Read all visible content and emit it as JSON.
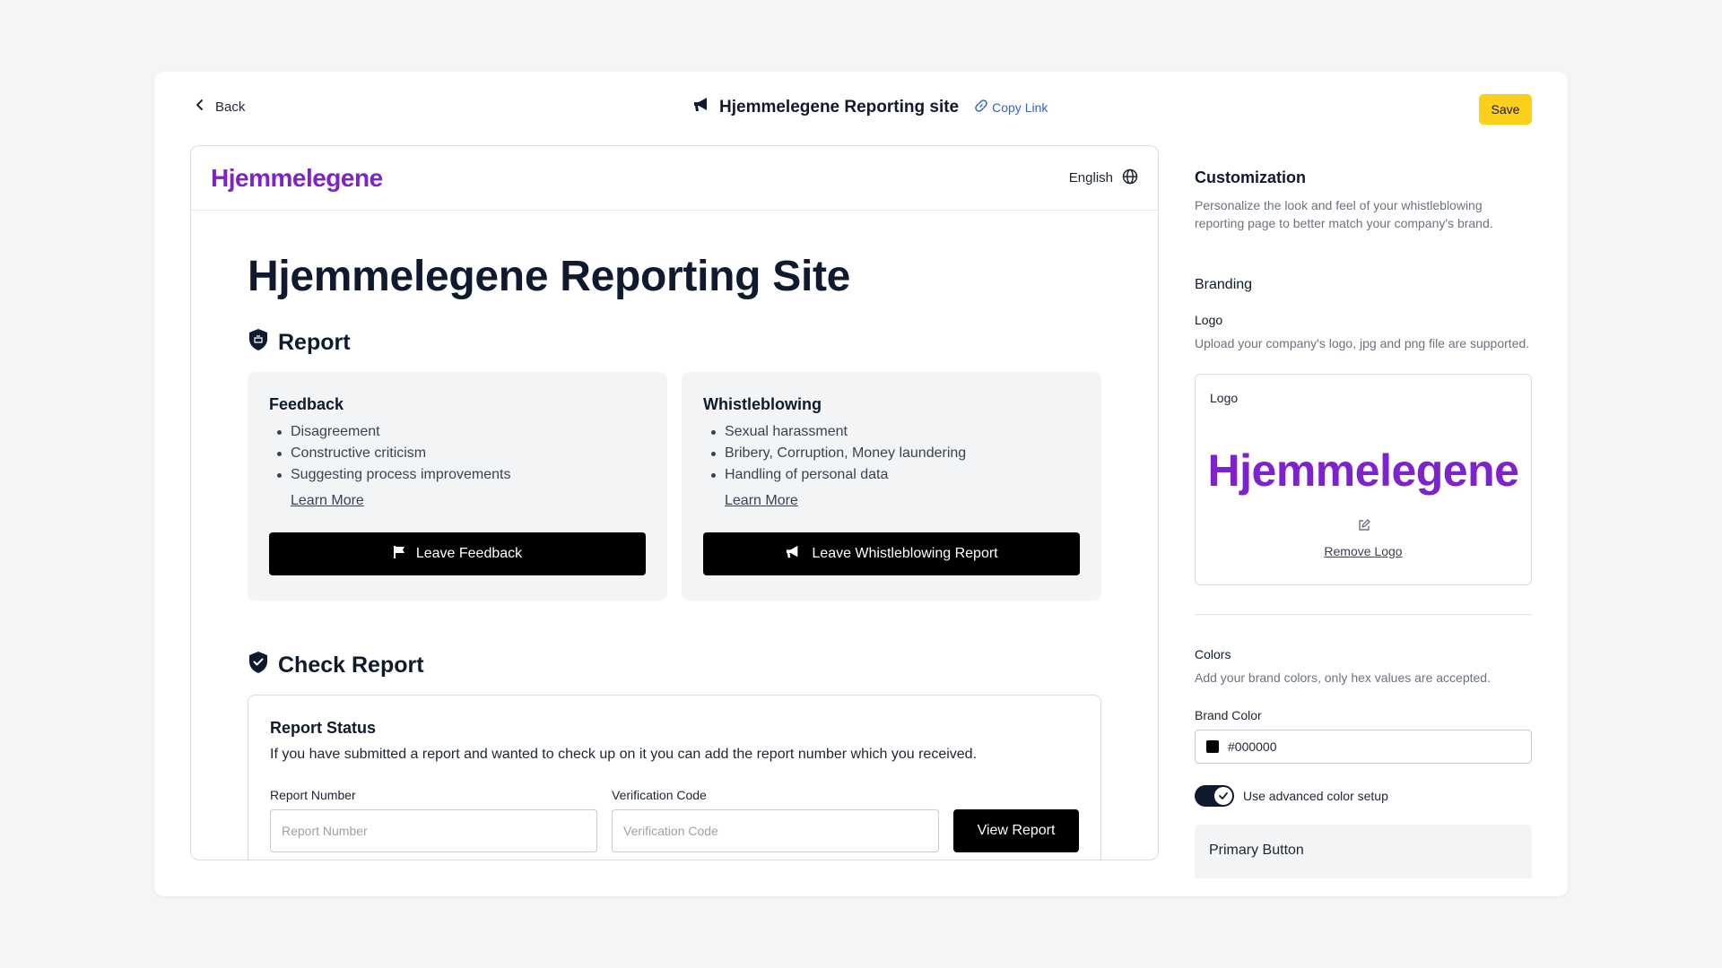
{
  "header": {
    "back_label": "Back",
    "title": "Hjemmelegene Reporting site",
    "copy_link": "Copy Link",
    "save_label": "Save"
  },
  "preview": {
    "logo_text": "Hjemmelegene",
    "language": "English",
    "heading": "Hjemmelegene Reporting Site",
    "report_section": "Report",
    "cards": [
      {
        "title": "Feedback",
        "items": [
          "Disagreement",
          "Constructive criticism",
          "Suggesting process improvements"
        ],
        "learn_more": "Learn More",
        "button": "Leave Feedback"
      },
      {
        "title": "Whistleblowing",
        "items": [
          "Sexual harassment",
          "Bribery, Corruption, Money laundering",
          "Handling of personal data"
        ],
        "learn_more": "Learn More",
        "button": "Leave Whistleblowing Report"
      }
    ],
    "check_section": "Check Report",
    "status": {
      "title": "Report Status",
      "description": "If you have submitted a report and wanted to check up on it you can add the report number which you received.",
      "report_number_label": "Report Number",
      "report_number_placeholder": "Report Number",
      "verification_label": "Verification Code",
      "verification_placeholder": "Verification Code",
      "view_button": "View Report"
    }
  },
  "panel": {
    "title": "Customization",
    "description": "Personalize the look and feel of your whistleblowing reporting page to better match your company's brand.",
    "branding": "Branding",
    "logo_label": "Logo",
    "logo_hint": "Upload your company's logo, jpg and png file are supported.",
    "logo_box_label": "Logo",
    "logo_text": "Hjemmelegene",
    "remove_logo": "Remove Logo",
    "colors_label": "Colors",
    "colors_hint": "Add your brand colors, only hex values are accepted.",
    "brand_color_label": "Brand Color",
    "brand_color_value": "#000000",
    "advanced_label": "Use advanced color setup",
    "advanced_enabled": true,
    "primary_button_label": "Primary Button"
  },
  "colors": {
    "accent_yellow": "#fccf1a",
    "logo_purple": "#7e22ce",
    "navy": "#0f1a2e"
  }
}
